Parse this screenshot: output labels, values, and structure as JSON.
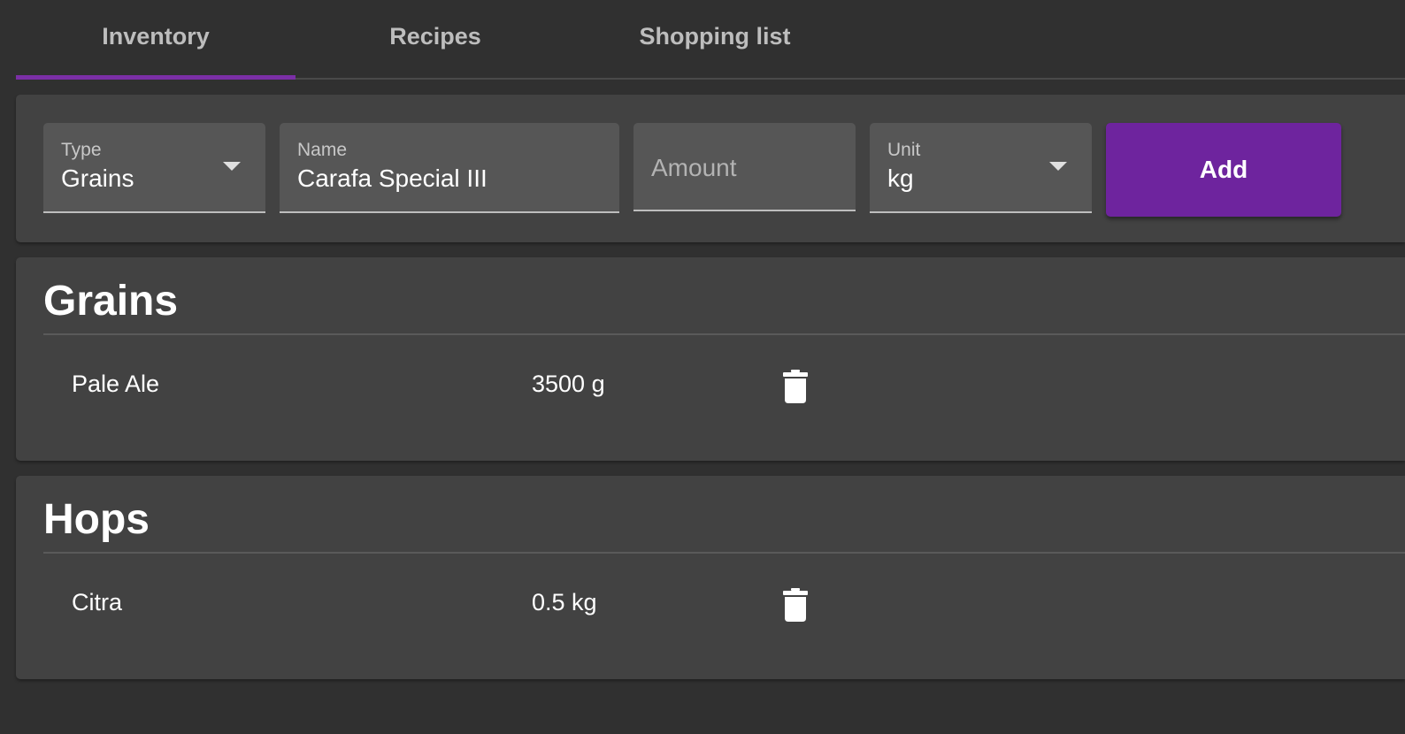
{
  "tabs": [
    {
      "label": "Inventory",
      "active": true
    },
    {
      "label": "Recipes",
      "active": false
    },
    {
      "label": "Shopping list",
      "active": false
    }
  ],
  "form": {
    "type": {
      "label": "Type",
      "value": "Grains"
    },
    "name": {
      "label": "Name",
      "value": "Carafa Special III"
    },
    "amount": {
      "placeholder": "Amount",
      "value": ""
    },
    "unit": {
      "label": "Unit",
      "value": "kg"
    },
    "add_label": "Add"
  },
  "sections": [
    {
      "title": "Grains",
      "items": [
        {
          "name": "Pale Ale",
          "quantity": "3500 g"
        }
      ]
    },
    {
      "title": "Hops",
      "items": [
        {
          "name": "Citra",
          "quantity": "0.5 kg"
        }
      ]
    }
  ],
  "colors": {
    "background": "#303030",
    "card": "#424242",
    "field": "#565656",
    "accent": "#6e249e"
  },
  "icons": {
    "dropdown": "chevron-down-icon",
    "delete": "trash-icon"
  }
}
